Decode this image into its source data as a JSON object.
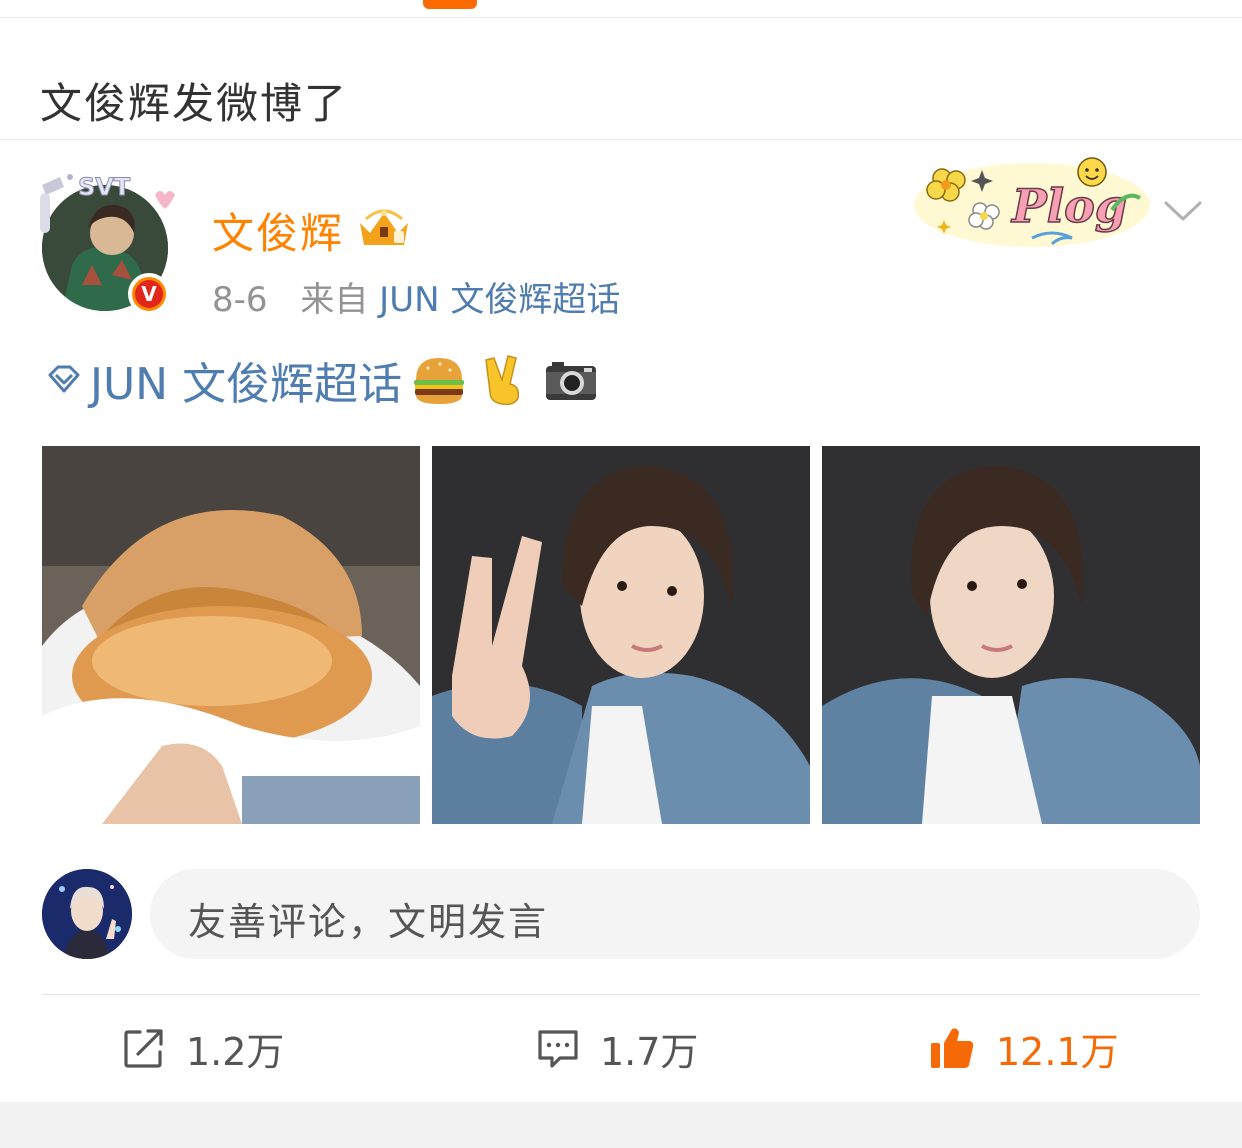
{
  "header": {
    "title": "文俊辉发微博了"
  },
  "post": {
    "username": "文俊辉",
    "date": "8-6",
    "source_prefix": "来自",
    "source": "JUN 文俊辉超话",
    "verified_badge": "V",
    "topic": "JUN 文俊辉超话",
    "emojis": [
      "hamburger-emoji",
      "victory-hand-emoji",
      "camera-emoji"
    ],
    "photos": [
      "photo-burger",
      "photo-selfie-peace",
      "photo-selfie"
    ],
    "sticker": "Plog"
  },
  "comment": {
    "placeholder": "友善评论，文明发言"
  },
  "actions": {
    "repost": "1.2万",
    "comment": "1.7万",
    "like": "12.1万"
  },
  "colors": {
    "accent": "#ff8200",
    "link": "#507daf",
    "like": "#f56a06",
    "indicator": "#ff6a00"
  }
}
